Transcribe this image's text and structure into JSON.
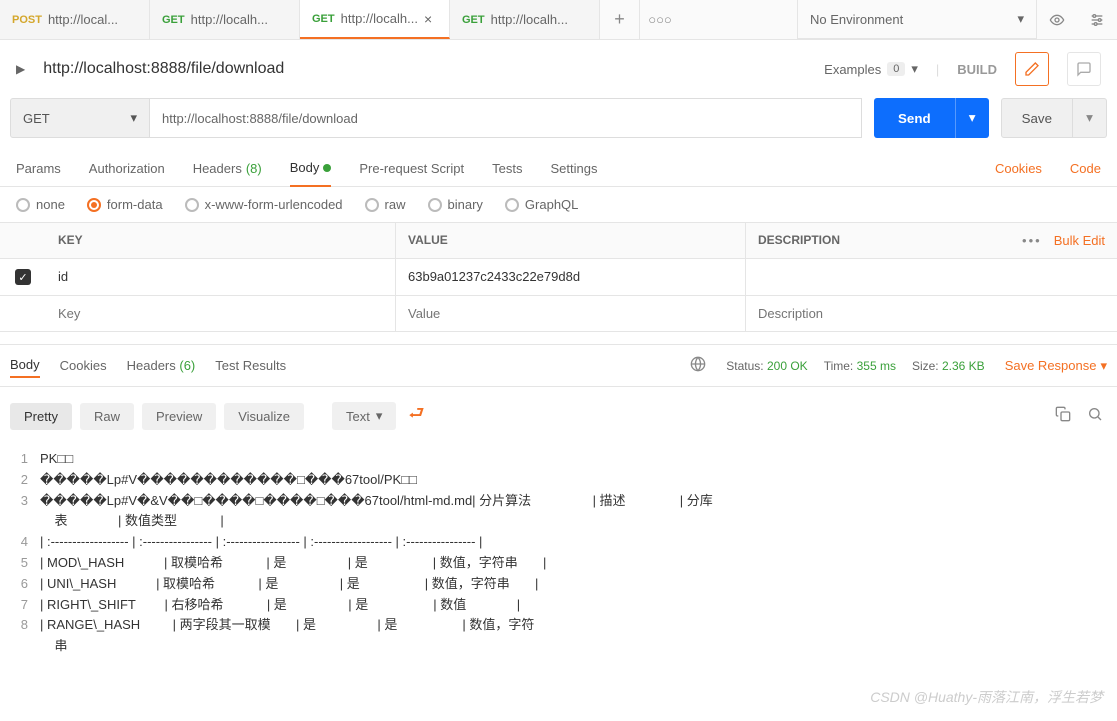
{
  "topbar": {
    "tabs": [
      {
        "method": "POST",
        "methodClass": "post",
        "label": "http://local..."
      },
      {
        "method": "GET",
        "methodClass": "get",
        "label": "http://localh..."
      },
      {
        "method": "GET",
        "methodClass": "get",
        "label": "http://localh...",
        "close": true,
        "active": true
      },
      {
        "method": "GET",
        "methodClass": "get",
        "label": "http://localh..."
      }
    ],
    "env": "No Environment"
  },
  "request": {
    "title": "http://localhost:8888/file/download",
    "examples_label": "Examples",
    "examples_count": "0",
    "build": "BUILD",
    "method": "GET",
    "url": "http://localhost:8888/file/download",
    "send": "Send",
    "save": "Save"
  },
  "reqtabs": {
    "params": "Params",
    "auth": "Authorization",
    "headers": "Headers",
    "headers_count": "(8)",
    "body": "Body",
    "prereq": "Pre-request Script",
    "tests": "Tests",
    "settings": "Settings",
    "cookies": "Cookies",
    "code": "Code"
  },
  "bodytypes": {
    "none": "none",
    "formdata": "form-data",
    "xwww": "x-www-form-urlencoded",
    "raw": "raw",
    "binary": "binary",
    "graphql": "GraphQL"
  },
  "kv": {
    "key_h": "KEY",
    "val_h": "VALUE",
    "desc_h": "DESCRIPTION",
    "bulk": "Bulk Edit",
    "rows": [
      {
        "checked": true,
        "key": "id",
        "value": "63b9a01237c2433c22e79d8d",
        "desc": ""
      }
    ],
    "ph_key": "Key",
    "ph_val": "Value",
    "ph_desc": "Description"
  },
  "resp": {
    "tabs": {
      "body": "Body",
      "cookies": "Cookies",
      "headers": "Headers",
      "headers_count": "(6)",
      "test": "Test Results"
    },
    "status_l": "Status:",
    "status_v": "200 OK",
    "time_l": "Time:",
    "time_v": "355 ms",
    "size_l": "Size:",
    "size_v": "2.36 KB",
    "save": "Save Response",
    "toolbar": {
      "pretty": "Pretty",
      "raw": "Raw",
      "preview": "Preview",
      "visualize": "Visualize",
      "text": "Text"
    },
    "lines": [
      "PK□□",
      "�����Lp#V������������□���67tool/PK□□",
      "�����Lp#V�&V��□����□����□���67tool/html-md.md| 分片算法                 | 描述               | 分库",
      "    表              | 数值类型            |",
      "| :------------------ | :---------------- | :----------------- | :------------------ | :---------------- |",
      "| MOD\\_HASH           | 取模哈希            | 是                 | 是                  | 数值，字符串       |",
      "| UNI\\_HASH           | 取模哈希            | 是                 | 是                  | 数值，字符串       |",
      "| RIGHT\\_SHIFT        | 右移哈希            | 是                 | 是                  | 数值              |",
      "| RANGE\\_HASH         | 两字段其一取模       | 是                 | 是                  | 数值，字符",
      "    串"
    ]
  },
  "watermark": "CSDN @Huathy-雨落江南，浮生若梦"
}
